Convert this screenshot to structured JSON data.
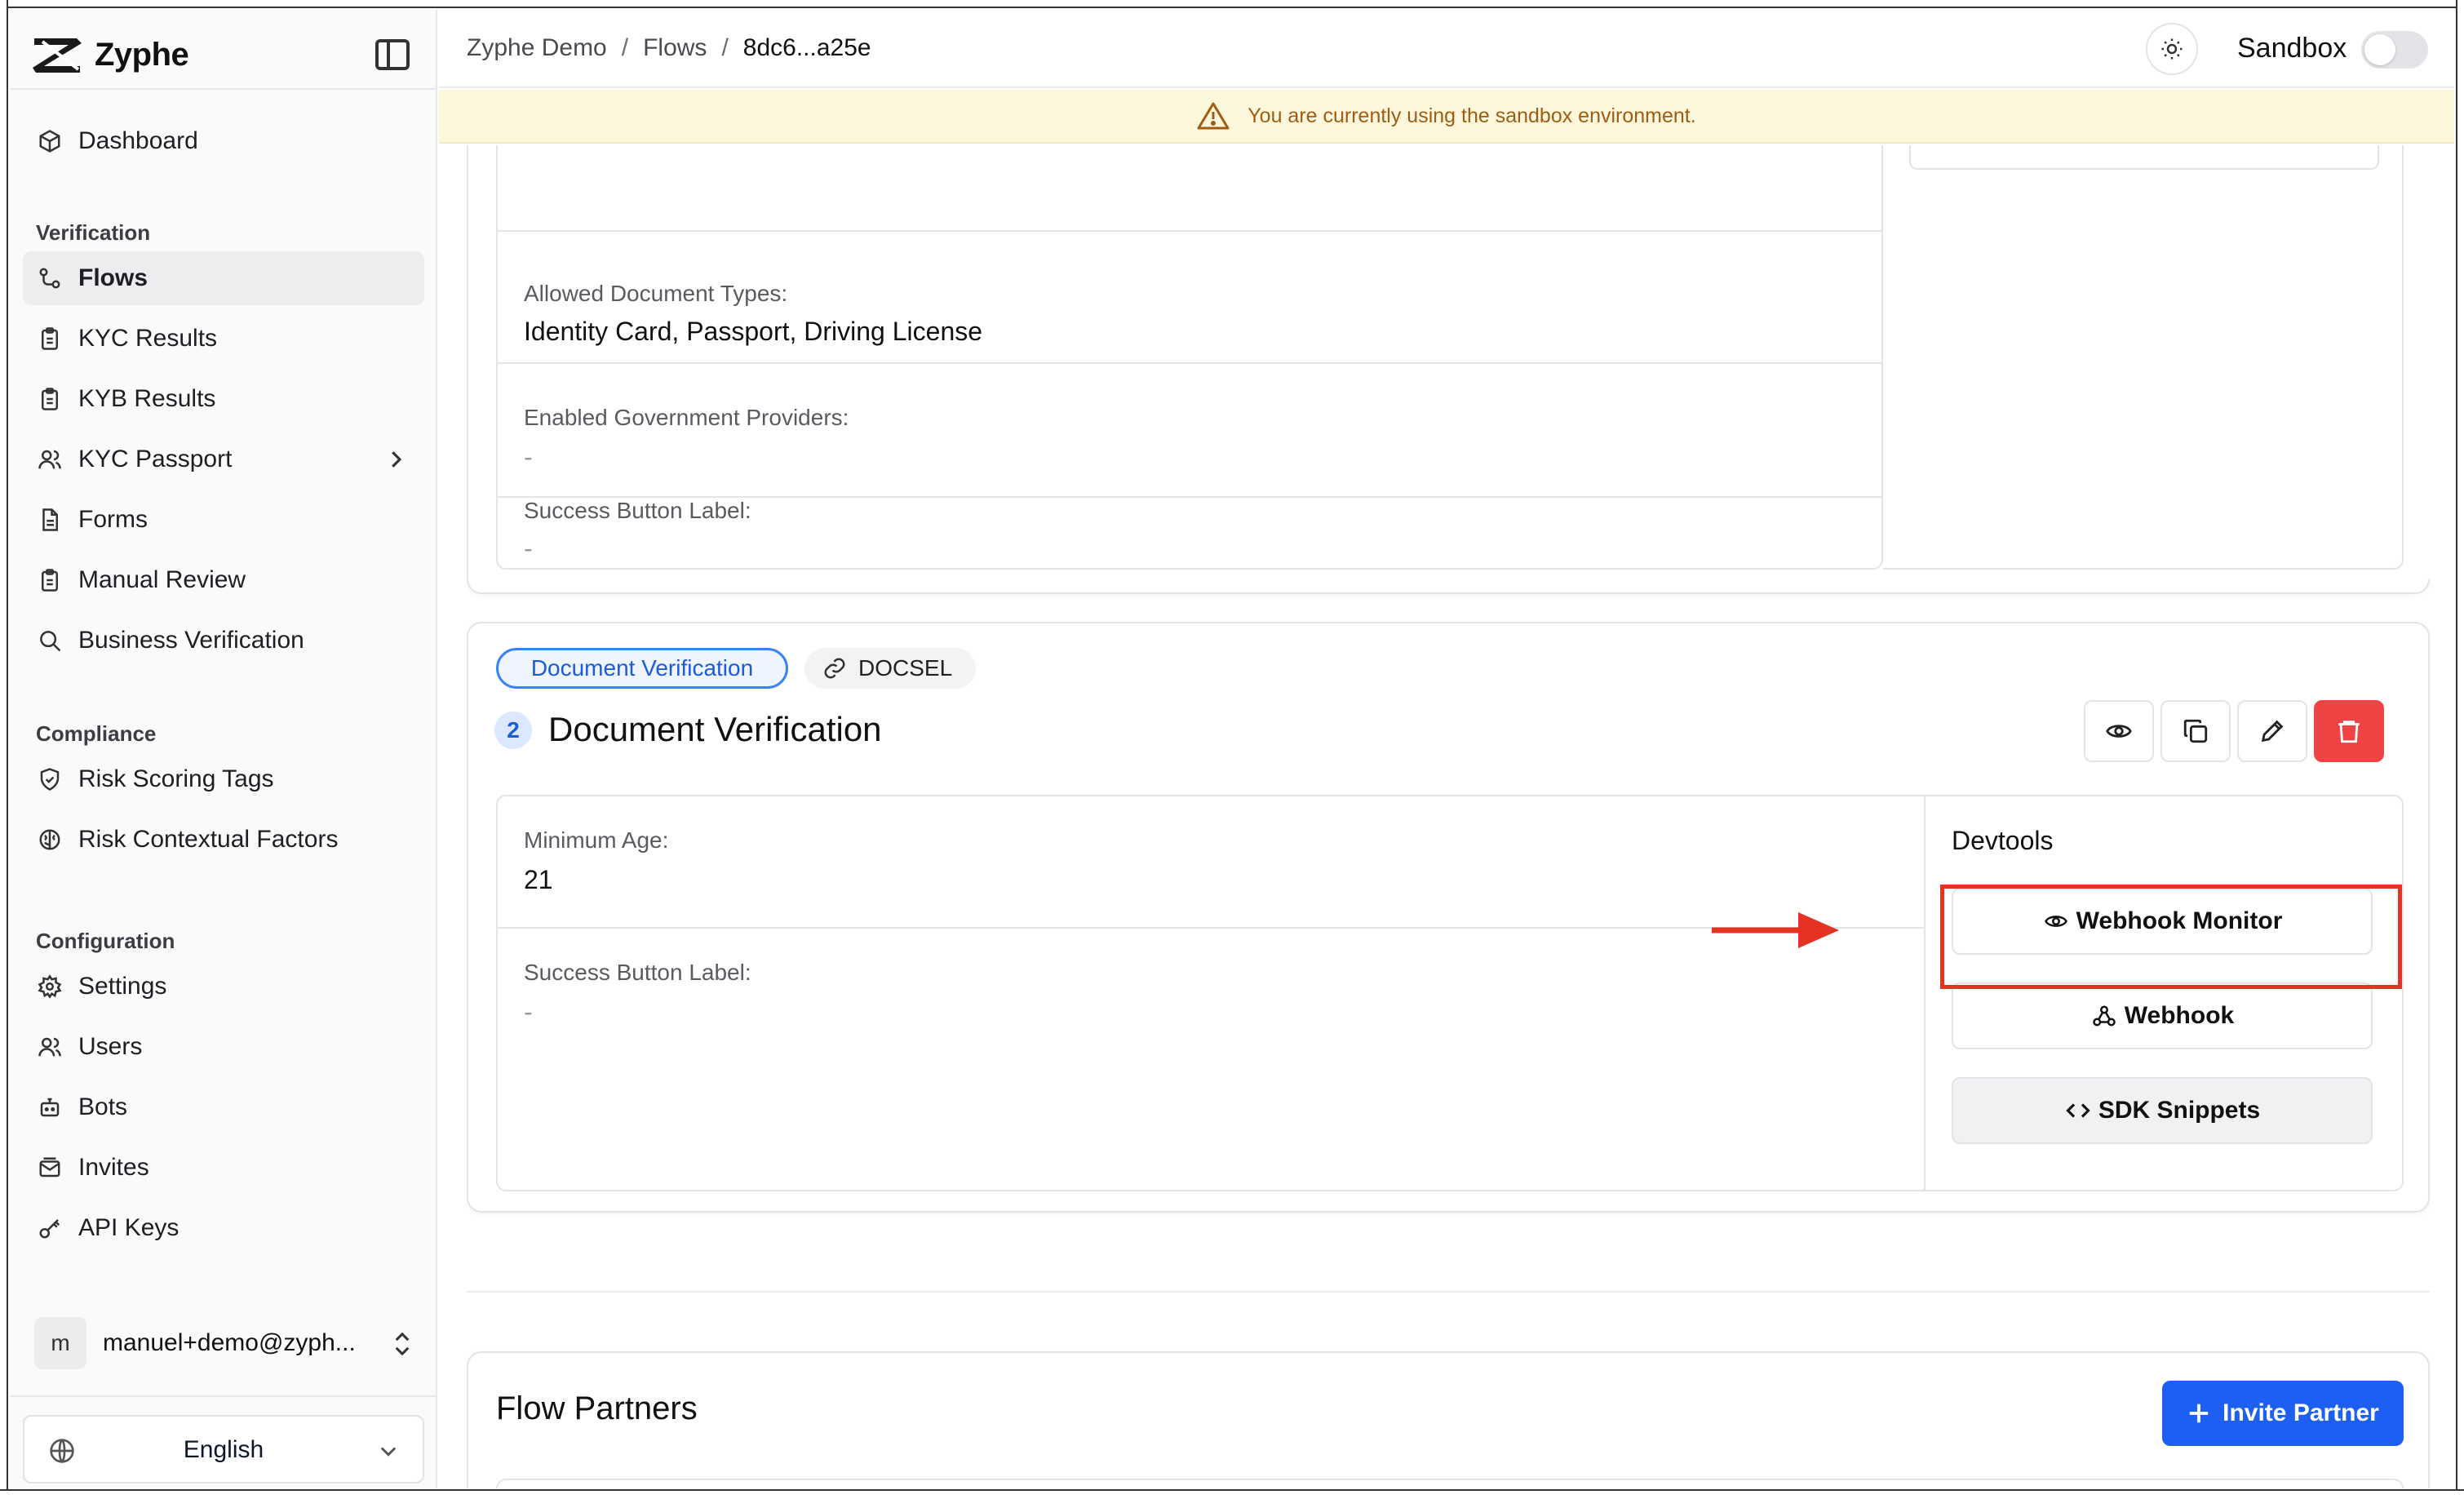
{
  "app": {
    "name": "Zyphe"
  },
  "breadcrumb": {
    "root": "Zyphe Demo",
    "section": "Flows",
    "current": "8dc6...a25e",
    "sep": "/"
  },
  "topbar": {
    "environment_label": "Sandbox",
    "sandbox_enabled": false
  },
  "banner": {
    "text": "You are currently using the sandbox environment."
  },
  "sidebar": {
    "dashboard": "Dashboard",
    "sections": {
      "verification": "Verification",
      "compliance": "Compliance",
      "configuration": "Configuration"
    },
    "verification_items": [
      "Flows",
      "KYC Results",
      "KYB Results",
      "KYC Passport",
      "Forms",
      "Manual Review",
      "Business Verification"
    ],
    "compliance_items": [
      "Risk Scoring Tags",
      "Risk Contextual Factors"
    ],
    "configuration_items": [
      "Settings",
      "Users",
      "Bots",
      "Invites",
      "API Keys"
    ],
    "active_item": "Flows"
  },
  "account": {
    "avatar_letter": "m",
    "email": "manuel+demo@zyph..."
  },
  "language": {
    "selected": "English"
  },
  "previous_step": {
    "fields": [
      {
        "label": "Allowed Document Types:",
        "value": "Identity Card, Passport, Driving License"
      },
      {
        "label": "Enabled Government Providers:",
        "value": "-"
      },
      {
        "label": "Success Button Label:",
        "value": "-"
      }
    ]
  },
  "step": {
    "tag": "Document Verification",
    "code": "DOCSEL",
    "number": "2",
    "title": "Document Verification",
    "fields": [
      {
        "label": "Minimum Age:",
        "value": "21"
      },
      {
        "label": "Success Button Label:",
        "value": "-"
      }
    ],
    "devtools": {
      "title": "Devtools",
      "webhook_monitor": "Webhook Monitor",
      "webhook": "Webhook",
      "sdk_snippets": "SDK Snippets"
    }
  },
  "partners": {
    "title": "Flow Partners",
    "invite_button": "Invite Partner"
  },
  "colors": {
    "accent": "#1d5ff0",
    "danger": "#ef4444",
    "highlight": "#e53222",
    "banner_bg": "#fdf8dc",
    "banner_text": "#a05c12"
  }
}
